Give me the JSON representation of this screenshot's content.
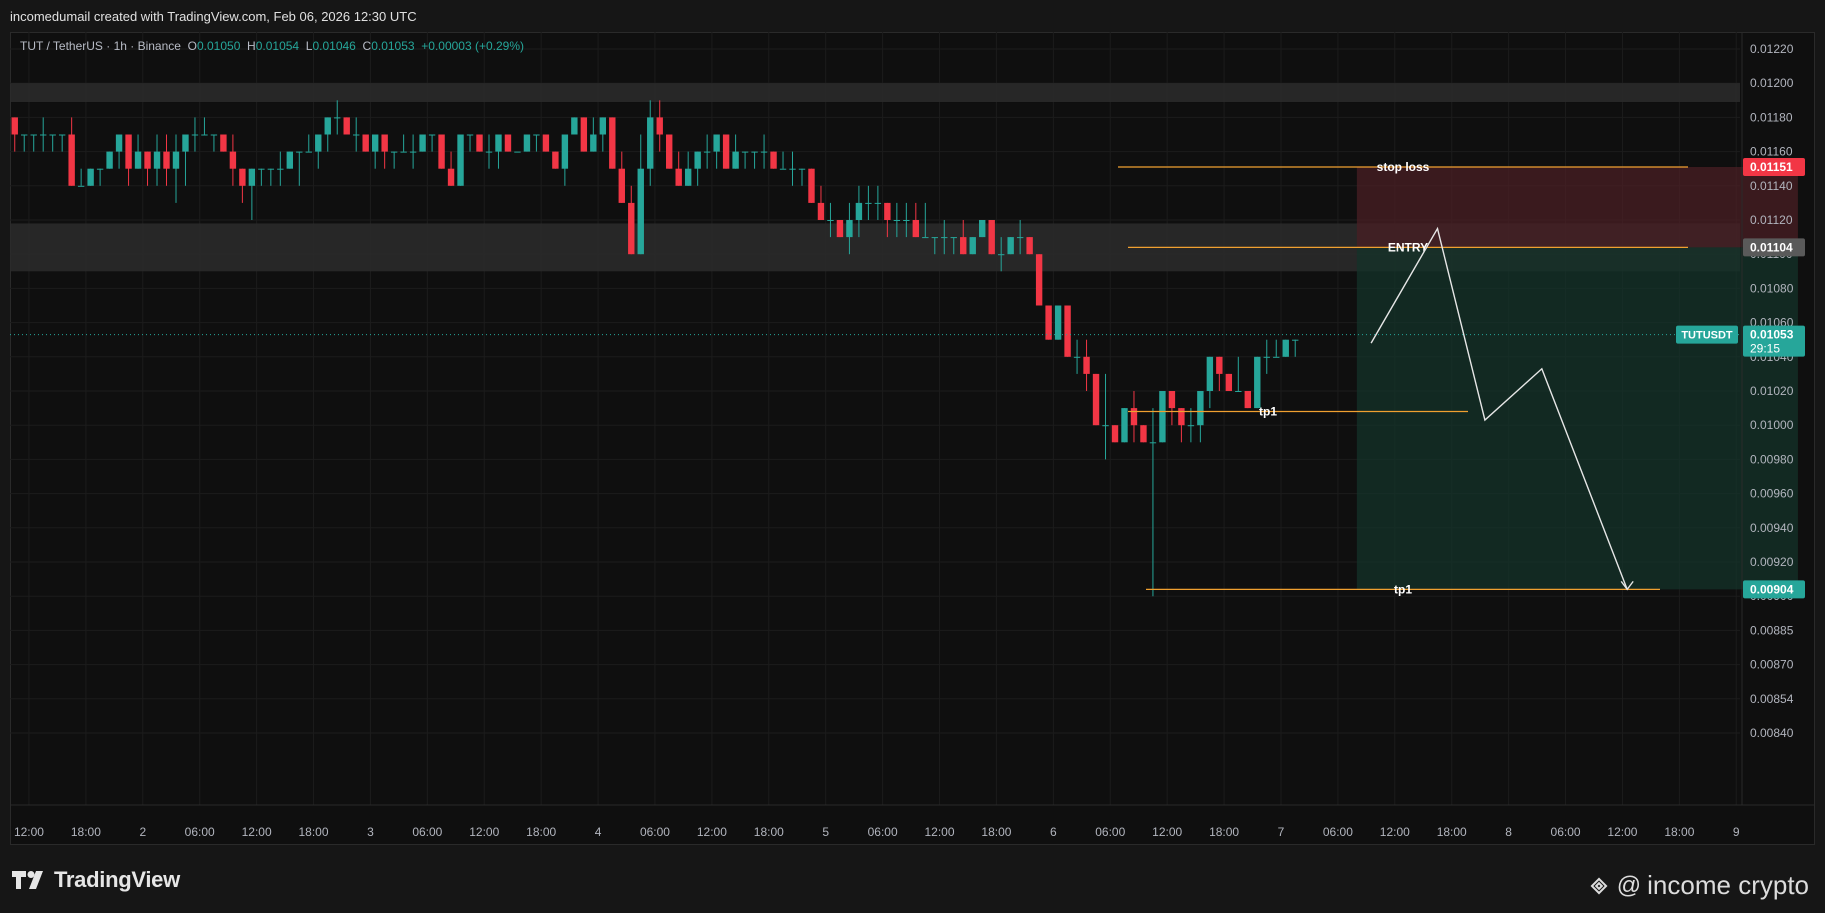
{
  "header": {
    "credit": "incomedumail created with TradingView.com, Feb 06, 2026 12:30 UTC"
  },
  "legend": {
    "symbol": "TUT / TetherUS · 1h · Binance",
    "o_label": "O",
    "o_value": "0.01050",
    "h_label": "H",
    "h_value": "0.01054",
    "l_label": "L",
    "l_value": "0.01046",
    "c_label": "C",
    "c_value": "0.01053",
    "change": "+0.00003 (+0.29%)"
  },
  "footer": {
    "logo_text": "TradingView",
    "watermark_at": "@",
    "watermark_text": "income crypto"
  },
  "colors": {
    "up": "#26a69a",
    "down": "#f23645",
    "level": "#f0a030",
    "stop_zone": "#4a1f24",
    "target_zone": "#143329",
    "zone_band": "#2b2b2b",
    "path": "#e6e6e6"
  },
  "chart_data": {
    "type": "candlestick",
    "price_scale": {
      "ticks": [
        "0.01220",
        "0.01200",
        "0.01180",
        "0.01160",
        "0.01140",
        "0.01120",
        "0.01100",
        "0.01080",
        "0.01060",
        "0.01040",
        "0.01020",
        "0.01000",
        "0.00980",
        "0.00960",
        "0.00940",
        "0.00920",
        "0.00900",
        "0.00885",
        "0.00870",
        "0.00854",
        "0.00840"
      ],
      "tick_values": [
        0.0122,
        0.012,
        0.0118,
        0.0116,
        0.0114,
        0.0112,
        0.011,
        0.0108,
        0.0106,
        0.0104,
        0.0102,
        0.01,
        0.0098,
        0.0096,
        0.0094,
        0.0092,
        0.009,
        0.00885,
        0.0087,
        0.00854,
        0.0084
      ]
    },
    "time_axis": {
      "labels": [
        "12:00",
        "18:00",
        "2",
        "06:00",
        "12:00",
        "18:00",
        "3",
        "06:00",
        "12:00",
        "18:00",
        "4",
        "06:00",
        "12:00",
        "18:00",
        "5",
        "06:00",
        "12:00",
        "18:00",
        "6",
        "06:00",
        "12:00",
        "18:00",
        "7",
        "06:00",
        "12:00",
        "18:00",
        "8",
        "06:00",
        "12:00",
        "18:00",
        "9"
      ],
      "first_label_bar": 2,
      "bars_per_label": 6
    },
    "candles": [
      [
        0.0118,
        0.0118,
        0.0116,
        0.0117
      ],
      [
        0.0117,
        0.0117,
        0.0116,
        0.0117
      ],
      [
        0.0117,
        0.0117,
        0.0116,
        0.0117
      ],
      [
        0.0117,
        0.0118,
        0.0116,
        0.0117
      ],
      [
        0.0117,
        0.0117,
        0.0116,
        0.0117
      ],
      [
        0.0117,
        0.0117,
        0.0116,
        0.0117
      ],
      [
        0.0117,
        0.0118,
        0.0114,
        0.0114
      ],
      [
        0.0114,
        0.0115,
        0.0114,
        0.0114
      ],
      [
        0.0114,
        0.0115,
        0.0114,
        0.0115
      ],
      [
        0.0115,
        0.0115,
        0.0114,
        0.0115
      ],
      [
        0.0115,
        0.0116,
        0.0115,
        0.0116
      ],
      [
        0.0116,
        0.0117,
        0.0115,
        0.0117
      ],
      [
        0.0117,
        0.0117,
        0.0114,
        0.0115
      ],
      [
        0.0115,
        0.0117,
        0.0115,
        0.0116
      ],
      [
        0.0116,
        0.0116,
        0.0114,
        0.0115
      ],
      [
        0.0115,
        0.0117,
        0.0114,
        0.0116
      ],
      [
        0.0116,
        0.0117,
        0.0114,
        0.0115
      ],
      [
        0.0115,
        0.0117,
        0.0113,
        0.0116
      ],
      [
        0.0116,
        0.0117,
        0.0114,
        0.0117
      ],
      [
        0.0117,
        0.0118,
        0.0116,
        0.0117
      ],
      [
        0.0117,
        0.0118,
        0.0117,
        0.0117
      ],
      [
        0.0117,
        0.0117,
        0.0116,
        0.0117
      ],
      [
        0.0117,
        0.0117,
        0.0116,
        0.0116
      ],
      [
        0.0116,
        0.0117,
        0.0114,
        0.0115
      ],
      [
        0.0115,
        0.0115,
        0.0113,
        0.0114
      ],
      [
        0.0114,
        0.0115,
        0.0112,
        0.0115
      ],
      [
        0.0115,
        0.0115,
        0.0114,
        0.0115
      ],
      [
        0.0115,
        0.0115,
        0.0114,
        0.0115
      ],
      [
        0.0115,
        0.0116,
        0.0114,
        0.0115
      ],
      [
        0.0115,
        0.0116,
        0.0115,
        0.0116
      ],
      [
        0.0116,
        0.0116,
        0.0114,
        0.0116
      ],
      [
        0.0116,
        0.0117,
        0.0116,
        0.0116
      ],
      [
        0.0116,
        0.0117,
        0.0115,
        0.0117
      ],
      [
        0.0117,
        0.0118,
        0.0116,
        0.0118
      ],
      [
        0.0118,
        0.0119,
        0.0117,
        0.0118
      ],
      [
        0.0118,
        0.0118,
        0.0117,
        0.0117
      ],
      [
        0.0117,
        0.0118,
        0.0116,
        0.0117
      ],
      [
        0.0117,
        0.0117,
        0.0116,
        0.0116
      ],
      [
        0.0116,
        0.0117,
        0.0115,
        0.0117
      ],
      [
        0.0117,
        0.0117,
        0.0115,
        0.0116
      ],
      [
        0.0116,
        0.0116,
        0.0115,
        0.0116
      ],
      [
        0.0116,
        0.0117,
        0.0116,
        0.0116
      ],
      [
        0.0116,
        0.0117,
        0.0115,
        0.0116
      ],
      [
        0.0116,
        0.0117,
        0.0116,
        0.0117
      ],
      [
        0.0117,
        0.0117,
        0.0116,
        0.0117
      ],
      [
        0.0117,
        0.0117,
        0.0115,
        0.0115
      ],
      [
        0.0115,
        0.0116,
        0.0114,
        0.0114
      ],
      [
        0.0114,
        0.0117,
        0.0114,
        0.0117
      ],
      [
        0.0117,
        0.0117,
        0.0116,
        0.0117
      ],
      [
        0.0117,
        0.0117,
        0.0116,
        0.0116
      ],
      [
        0.0116,
        0.0117,
        0.0115,
        0.0116
      ],
      [
        0.0116,
        0.0117,
        0.0115,
        0.0117
      ],
      [
        0.0117,
        0.0117,
        0.0116,
        0.0116
      ],
      [
        0.0116,
        0.0116,
        0.0116,
        0.0116
      ],
      [
        0.0116,
        0.0117,
        0.0116,
        0.0117
      ],
      [
        0.0117,
        0.0117,
        0.0116,
        0.0117
      ],
      [
        0.0117,
        0.0117,
        0.0116,
        0.0116
      ],
      [
        0.0116,
        0.0116,
        0.0115,
        0.0115
      ],
      [
        0.0115,
        0.0117,
        0.0114,
        0.0117
      ],
      [
        0.0117,
        0.0118,
        0.0117,
        0.0118
      ],
      [
        0.0118,
        0.0118,
        0.0116,
        0.0116
      ],
      [
        0.0116,
        0.0118,
        0.0116,
        0.0117
      ],
      [
        0.0117,
        0.0118,
        0.0116,
        0.0118
      ],
      [
        0.0118,
        0.0118,
        0.0115,
        0.0115
      ],
      [
        0.0115,
        0.0116,
        0.0113,
        0.0113
      ],
      [
        0.0113,
        0.0114,
        0.011,
        0.011
      ],
      [
        0.011,
        0.0117,
        0.011,
        0.0115
      ],
      [
        0.0115,
        0.0119,
        0.0114,
        0.0118
      ],
      [
        0.0118,
        0.0119,
        0.0116,
        0.0117
      ],
      [
        0.0117,
        0.0117,
        0.0115,
        0.0115
      ],
      [
        0.0115,
        0.0116,
        0.0114,
        0.0114
      ],
      [
        0.0114,
        0.0116,
        0.0114,
        0.0115
      ],
      [
        0.0115,
        0.0116,
        0.0114,
        0.0116
      ],
      [
        0.0116,
        0.0117,
        0.0115,
        0.0116
      ],
      [
        0.0116,
        0.0117,
        0.0115,
        0.0117
      ],
      [
        0.0117,
        0.0117,
        0.0115,
        0.0115
      ],
      [
        0.0115,
        0.0117,
        0.0115,
        0.0116
      ],
      [
        0.0116,
        0.0116,
        0.0115,
        0.0116
      ],
      [
        0.0116,
        0.0116,
        0.0115,
        0.0116
      ],
      [
        0.0116,
        0.0117,
        0.0115,
        0.0116
      ],
      [
        0.0116,
        0.0116,
        0.0115,
        0.0115
      ],
      [
        0.0115,
        0.0116,
        0.0115,
        0.0115
      ],
      [
        0.0115,
        0.0116,
        0.0114,
        0.0115
      ],
      [
        0.0115,
        0.0115,
        0.0114,
        0.0115
      ],
      [
        0.0115,
        0.0115,
        0.0113,
        0.0113
      ],
      [
        0.0113,
        0.0114,
        0.0112,
        0.0112
      ],
      [
        0.0112,
        0.0113,
        0.0111,
        0.0112
      ],
      [
        0.0112,
        0.0112,
        0.0111,
        0.0111
      ],
      [
        0.0111,
        0.0113,
        0.011,
        0.0112
      ],
      [
        0.0112,
        0.0114,
        0.0111,
        0.0113
      ],
      [
        0.0113,
        0.0114,
        0.0112,
        0.0113
      ],
      [
        0.0113,
        0.0114,
        0.0112,
        0.0113
      ],
      [
        0.0113,
        0.0113,
        0.0111,
        0.0112
      ],
      [
        0.0112,
        0.0113,
        0.0111,
        0.0112
      ],
      [
        0.0112,
        0.0113,
        0.0111,
        0.0112
      ],
      [
        0.0112,
        0.0113,
        0.0111,
        0.0111
      ],
      [
        0.0111,
        0.0113,
        0.0111,
        0.0111
      ],
      [
        0.0111,
        0.0111,
        0.011,
        0.0111
      ],
      [
        0.0111,
        0.0112,
        0.011,
        0.0111
      ],
      [
        0.0111,
        0.0111,
        0.011,
        0.0111
      ],
      [
        0.0111,
        0.0112,
        0.011,
        0.011
      ],
      [
        0.011,
        0.0111,
        0.011,
        0.0111
      ],
      [
        0.0111,
        0.0112,
        0.0111,
        0.0112
      ],
      [
        0.0112,
        0.0112,
        0.011,
        0.011
      ],
      [
        0.011,
        0.0111,
        0.0109,
        0.011
      ],
      [
        0.011,
        0.0111,
        0.011,
        0.0111
      ],
      [
        0.0111,
        0.0112,
        0.011,
        0.0111
      ],
      [
        0.0111,
        0.0111,
        0.011,
        0.011
      ],
      [
        0.011,
        0.011,
        0.0107,
        0.0107
      ],
      [
        0.0107,
        0.0107,
        0.0105,
        0.0105
      ],
      [
        0.0105,
        0.0107,
        0.0105,
        0.0107
      ],
      [
        0.0107,
        0.0107,
        0.0104,
        0.0104
      ],
      [
        0.0104,
        0.0105,
        0.0103,
        0.0104
      ],
      [
        0.0104,
        0.0105,
        0.0102,
        0.0103
      ],
      [
        0.0103,
        0.0103,
        0.01,
        0.01
      ],
      [
        0.01,
        0.0103,
        0.0098,
        0.01
      ],
      [
        0.01,
        0.01,
        0.0099,
        0.0099
      ],
      [
        0.0099,
        0.0101,
        0.0099,
        0.0101
      ],
      [
        0.0101,
        0.0102,
        0.0099,
        0.01
      ],
      [
        0.01,
        0.01,
        0.0099,
        0.0099
      ],
      [
        0.0099,
        0.0101,
        0.009,
        0.0099
      ],
      [
        0.0099,
        0.0102,
        0.0099,
        0.0102
      ],
      [
        0.0102,
        0.0102,
        0.01,
        0.0101
      ],
      [
        0.0101,
        0.0101,
        0.0099,
        0.01
      ],
      [
        0.01,
        0.0101,
        0.0099,
        0.01
      ],
      [
        0.01,
        0.0102,
        0.0099,
        0.0102
      ],
      [
        0.0102,
        0.0104,
        0.0101,
        0.0104
      ],
      [
        0.0104,
        0.0104,
        0.0102,
        0.0103
      ],
      [
        0.0103,
        0.0103,
        0.0102,
        0.0102
      ],
      [
        0.0102,
        0.0104,
        0.0102,
        0.0102
      ],
      [
        0.0102,
        0.0102,
        0.0101,
        0.0101
      ],
      [
        0.0101,
        0.0104,
        0.0101,
        0.0104
      ],
      [
        0.0104,
        0.0105,
        0.0103,
        0.0104
      ],
      [
        0.0104,
        0.0105,
        0.0104,
        0.0104
      ],
      [
        0.0104,
        0.0105,
        0.0104,
        0.0105
      ],
      [
        0.0105,
        0.0105,
        0.0104,
        0.0105
      ]
    ],
    "candles_note_order": "open, high, low, close",
    "last_price": {
      "label": "TUTUSDT",
      "value": "0.01053",
      "countdown": "29:15",
      "price": 0.01053
    },
    "levels": [
      {
        "name": "stop loss",
        "price": 0.01151,
        "tag": "0.01151"
      },
      {
        "name": "ENTRY",
        "price": 0.01104,
        "tag": "0.01104"
      },
      {
        "name": "tp1",
        "price": 0.01008
      },
      {
        "name": "tp1",
        "price": 0.00904,
        "tag": "0.00904"
      }
    ],
    "zones": [
      {
        "kind": "resistance",
        "from": 0.012,
        "to": 0.01189
      },
      {
        "kind": "support",
        "from": 0.01118,
        "to": 0.0109
      }
    ],
    "projection": [
      [
        143,
        0.01048
      ],
      [
        150,
        0.01115
      ],
      [
        155,
        0.01003
      ],
      [
        161,
        0.01033
      ],
      [
        170,
        0.00904
      ]
    ],
    "risk_box": {
      "stop": 0.01151,
      "entry": 0.01104,
      "target": 0.00904,
      "from_bar": 142,
      "to_bar": 188
    }
  }
}
